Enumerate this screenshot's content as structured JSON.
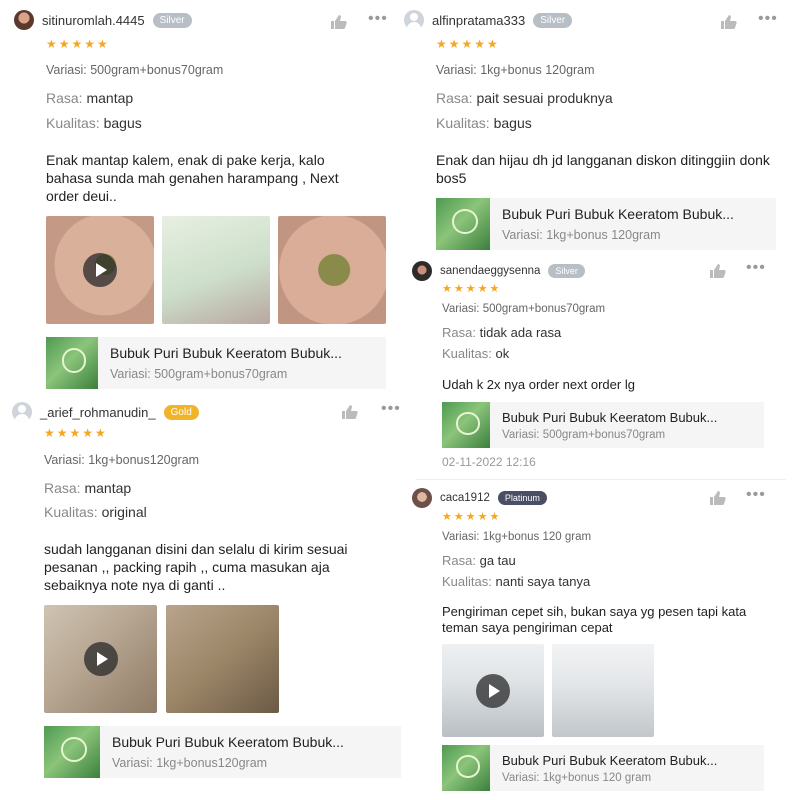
{
  "reviews": [
    {
      "username": "sitinuromlah.4445",
      "badge": "Silver",
      "stars": "★★★★★",
      "variation": "Variasi: 500gram+bonus70gram",
      "rasa_label": "Rasa:",
      "rasa": "mantap",
      "kualitas_label": "Kualitas:",
      "kualitas": "bagus",
      "comment": "Enak mantap kalem, enak di pake kerja, kalo bahasa sunda mah genahen harampang , Next order deui..",
      "product_name": "Bubuk Puri Bubuk Keeratom Bubuk...",
      "product_variation": "Variasi: 500gram+bonus70gram"
    },
    {
      "username": "_arief_rohmanudin_",
      "badge": "Gold",
      "stars": "★★★★★",
      "variation": "Variasi: 1kg+bonus120gram",
      "rasa_label": "Rasa:",
      "rasa": "mantap",
      "kualitas_label": "Kualitas:",
      "kualitas": "original",
      "comment": "sudah langganan disini dan selalu di kirim sesuai pesanan ,, packing rapih ,, cuma masukan aja sebaiknya note nya di ganti ..",
      "product_name": "Bubuk Puri Bubuk Keeratom Bubuk...",
      "product_variation": "Variasi: 1kg+bonus120gram"
    },
    {
      "username": "alfinpratama333",
      "badge": "Silver",
      "stars": "★★★★★",
      "variation": "Variasi: 1kg+bonus 120gram",
      "rasa_label": "Rasa:",
      "rasa": "pait sesuai produknya",
      "kualitas_label": "Kualitas:",
      "kualitas": "bagus",
      "comment": "Enak dan hijau dh jd langganan diskon ditinggiin donk bos5",
      "product_name": "Bubuk Puri Bubuk Keeratom Bubuk...",
      "product_variation": "Variasi: 1kg+bonus 120gram"
    },
    {
      "username": "sanendaeggysenna",
      "badge": "Silver",
      "stars": "★★★★★",
      "variation": "Variasi: 500gram+bonus70gram",
      "rasa_label": "Rasa:",
      "rasa": "tidak ada rasa",
      "kualitas_label": "Kualitas:",
      "kualitas": "ok",
      "comment": "Udah k 2x nya order next order lg",
      "product_name": "Bubuk Puri Bubuk Keeratom Bubuk...",
      "product_variation": "Variasi: 500gram+bonus70gram",
      "date": "02-11-2022 12:16"
    },
    {
      "username": "caca1912",
      "badge": "Platinum",
      "stars": "★★★★★",
      "variation": "Variasi: 1kg+bonus 120 gram",
      "rasa_label": "Rasa:",
      "rasa": "ga tau",
      "kualitas_label": "Kualitas:",
      "kualitas": "nanti saya tanya",
      "comment": "Pengiriman cepet sih, bukan saya yg pesen tapi kata teman saya pengiriman cepat",
      "product_name": "Bubuk Puri Bubuk Keeratom Bubuk...",
      "product_variation": "Variasi: 1kg+bonus 120 gram"
    }
  ],
  "icons": {
    "like": "thumbs-up-icon",
    "more": "more-icon",
    "play": "play-icon"
  },
  "colors": {
    "star": "#f5a623",
    "badge_silver": "#b8bec6",
    "badge_gold": "#f0b429",
    "badge_platinum": "#4a4f66"
  }
}
